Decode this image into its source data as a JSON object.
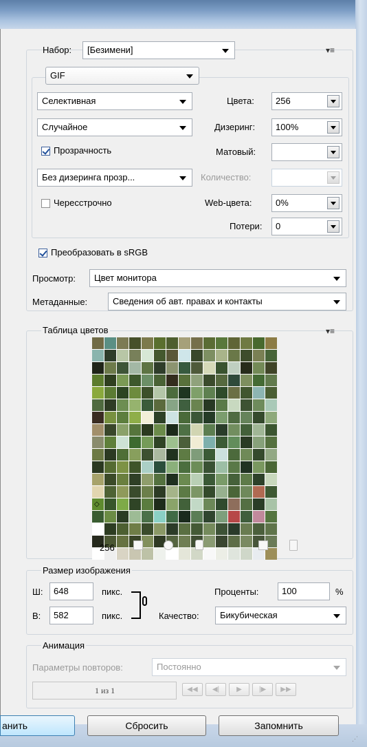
{
  "preset": {
    "label": "Набор:",
    "value": "[Безимени]"
  },
  "format": {
    "value": "GIF"
  },
  "reduction": {
    "value": "Селективная"
  },
  "dither_algo": {
    "value": "Случайное"
  },
  "transparency": {
    "label": "Прозрачность",
    "checked": true
  },
  "transp_dither": {
    "value": "Без дизеринга прозр..."
  },
  "interlaced": {
    "label": "Чересстрочно",
    "checked": false
  },
  "colors": {
    "label": "Цвета:",
    "value": "256"
  },
  "dither": {
    "label": "Дизеринг:",
    "value": "100%"
  },
  "matte": {
    "label": "Матовый:",
    "value": ""
  },
  "amount": {
    "label": "Количество:",
    "value": ""
  },
  "web_snap": {
    "label": "Web-цвета:",
    "value": "0%"
  },
  "lossy": {
    "label": "Потери:",
    "value": "0"
  },
  "convert_srgb": {
    "label": "Преобразовать в sRGB",
    "checked": true
  },
  "preview": {
    "label": "Просмотр:",
    "value": "Цвет монитора"
  },
  "metadata": {
    "label": "Метаданные:",
    "value": "Сведения об авт. правах и контакты"
  },
  "color_table": {
    "title": "Таблица цветов",
    "count": "256",
    "colors": [
      "#706b46",
      "#5a8f84",
      "#7c7b54",
      "#46502a",
      "#7c7a4c",
      "#5a6f2e",
      "#4e5e2f",
      "#a6a07a",
      "#756f4a",
      "#5a6c34",
      "#59783b",
      "#5f6536",
      "#6f7a43",
      "#48692e",
      "#8c7c45",
      "#8ab4ad",
      "#2e3c2a",
      "#b8c6a6",
      "#78805a",
      "#d7e8d6",
      "#44582e",
      "#5a5738",
      "#cfe6ea",
      "#39472a",
      "#7d8f62",
      "#a9b48a",
      "#6a7848",
      "#3e4d2c",
      "#7a8054",
      "#476438",
      "#1f2418",
      "#6d7b4a",
      "#3e5537",
      "#a3b8a5",
      "#5e7444",
      "#2f3d2a",
      "#8c9470",
      "#375a3f",
      "#4f5a3a",
      "#d6d9b8",
      "#39532f",
      "#bfcfc0",
      "#272c1b",
      "#738a57",
      "#3f4427",
      "#5c7c2d",
      "#2f3f1f",
      "#7b9a55",
      "#3d582c",
      "#6c8f67",
      "#4a6235",
      "#332c1d",
      "#58703b",
      "#90a27c",
      "#3b4b2c",
      "#56693f",
      "#2f4a3a",
      "#7e8f5f",
      "#446a34",
      "#617a4c",
      "#8aa93d",
      "#5b7b33",
      "#2c4422",
      "#6d8b3e",
      "#3d4f2b",
      "#b4c6a8",
      "#4c6b3d",
      "#1f3520",
      "#7fa06a",
      "#5e8050",
      "#2e4a2a",
      "#6b6f45",
      "#41562f",
      "#8db5b2",
      "#4a5e33",
      "#4f6a3f",
      "#2e3b24",
      "#6d8e52",
      "#96b36e",
      "#3a5c3a",
      "#5b6a3d",
      "#87a586",
      "#3f5f3f",
      "#6a8450",
      "#273923",
      "#5a7a48",
      "#c8d9c0",
      "#3d5233",
      "#6e8b5c",
      "#a9c9b8",
      "#3a2c22",
      "#78913f",
      "#5d7e3e",
      "#8fae49",
      "#f3f0d8",
      "#2d4127",
      "#cde3e3",
      "#4a6a3a",
      "#3b5637",
      "#243b26",
      "#7b9d6e",
      "#4f6b42",
      "#66835b",
      "#34492c",
      "#8ea97b",
      "#a28f6b",
      "#39462a",
      "#8aa16a",
      "#56753c",
      "#2b3a1f",
      "#6b8b4a",
      "#1b2a1a",
      "#4e7045",
      "#d1d5b2",
      "#5c7e50",
      "#2a3c2a",
      "#728e5f",
      "#43603a",
      "#a0b696",
      "#3b5530",
      "#8a8c6d",
      "#5f7f3a",
      "#cde2d5",
      "#3d6a2f",
      "#759b58",
      "#2f4425",
      "#9dc08e",
      "#4b5f3a",
      "#f0ecd4",
      "#7eb0ac",
      "#3c5b35",
      "#628d5b",
      "#2a3a24",
      "#87a17a",
      "#55713f",
      "#6d7a45",
      "#2c3a22",
      "#4f6e36",
      "#889f5d",
      "#3d5030",
      "#aab99f",
      "#21331f",
      "#5e7b44",
      "#7f9c7a",
      "#3b5a36",
      "#cbe0dd",
      "#4c6a3c",
      "#6f8a58",
      "#354a2d",
      "#92a884",
      "#2a3820",
      "#556b31",
      "#7d9245",
      "#3f5429",
      "#abcfc6",
      "#2b4e3b",
      "#8bb07b",
      "#4b6e3e",
      "#6c8d57",
      "#395133",
      "#9cbea5",
      "#5a7948",
      "#203222",
      "#7a9860",
      "#4a6636",
      "#a7a36b",
      "#3b4a28",
      "#6a7f3f",
      "#2f3f26",
      "#8f9d6c",
      "#54713f",
      "#1f2f1f",
      "#6b8a50",
      "#b9cfb5",
      "#3b5936",
      "#7a9b69",
      "#45613a",
      "#5e7b49",
      "#2d4129",
      "#c8d8bd",
      "#e1d6b0",
      "#4e6234",
      "#8f9a5b",
      "#3a4b2c",
      "#6c7f4b",
      "#2c3b24",
      "#a5b489",
      "#5c7a45",
      "#7c9666",
      "#344a2b",
      "#97b08f",
      "#4a6538",
      "#6f895b",
      "#b06a52",
      "#3e5933",
      "#5e8b2e",
      "#37562a",
      "#7eaa47",
      "#2f4426",
      "#5a7c3f",
      "#1e2c1b",
      "#8aa46a",
      "#42613a",
      "#c2d9c6",
      "#6b8858",
      "#2f4a2e",
      "#8e6e5c",
      "#546f43",
      "#2a3d27",
      "#a8c3a7",
      "#3a5d31",
      "#6b8c44",
      "#2a3b23",
      "#9dbb95",
      "#4a7048",
      "#8ad0c5",
      "#406a45",
      "#1b2b1d",
      "#5b7d56",
      "#2f452f",
      "#7d9f7c",
      "#b74848",
      "#3f5e3d",
      "#c1899c",
      "#557540",
      "#ffffff",
      "#2d3c22",
      "#4d5f31",
      "#6f7d46",
      "#3a4b2b",
      "#8a9866",
      "#2c3b28",
      "#5a6f42",
      "#445a36",
      "#758b5c",
      "#3d5236",
      "#2a3a2a",
      "#697c51",
      "#4b5f3c",
      "#5f744a",
      "#262a1d",
      "#4b5733",
      "#677241",
      "#3a4528",
      "#82905d",
      "#2f3a24",
      "#556440",
      "#6f7e53",
      "#404e33",
      "#8a9b73",
      "#3a4630",
      "#5e6e48",
      "#7a8a62",
      "#47553a",
      "#6a7b57",
      "#ffffff",
      "#efefef",
      "#d9d4c4",
      "#c9c6b1",
      "#bdc2a7",
      "#eef1ec",
      "#ffffff",
      "#e4e6d9",
      "#d2d8c7",
      "#f8f8f8",
      "#eceee6",
      "#dfe5dd",
      "#cfd7c9",
      "#e8ecf0",
      "#9d8f5a"
    ]
  },
  "image_size": {
    "title": "Размер изображения",
    "w_label": "Ш:",
    "w": "648",
    "h_label": "В:",
    "h": "582",
    "unit": "пикс.",
    "percent_label": "Проценты:",
    "percent": "100",
    "pct": "%",
    "quality_label": "Качество:",
    "quality": "Бикубическая"
  },
  "animation": {
    "title": "Анимация",
    "loop_label": "Параметры повторов:",
    "loop": "Постоянно",
    "frame": "1 из 1"
  },
  "buttons": {
    "save": "анить",
    "reset": "Сбросить",
    "remember": "Запомнить"
  }
}
